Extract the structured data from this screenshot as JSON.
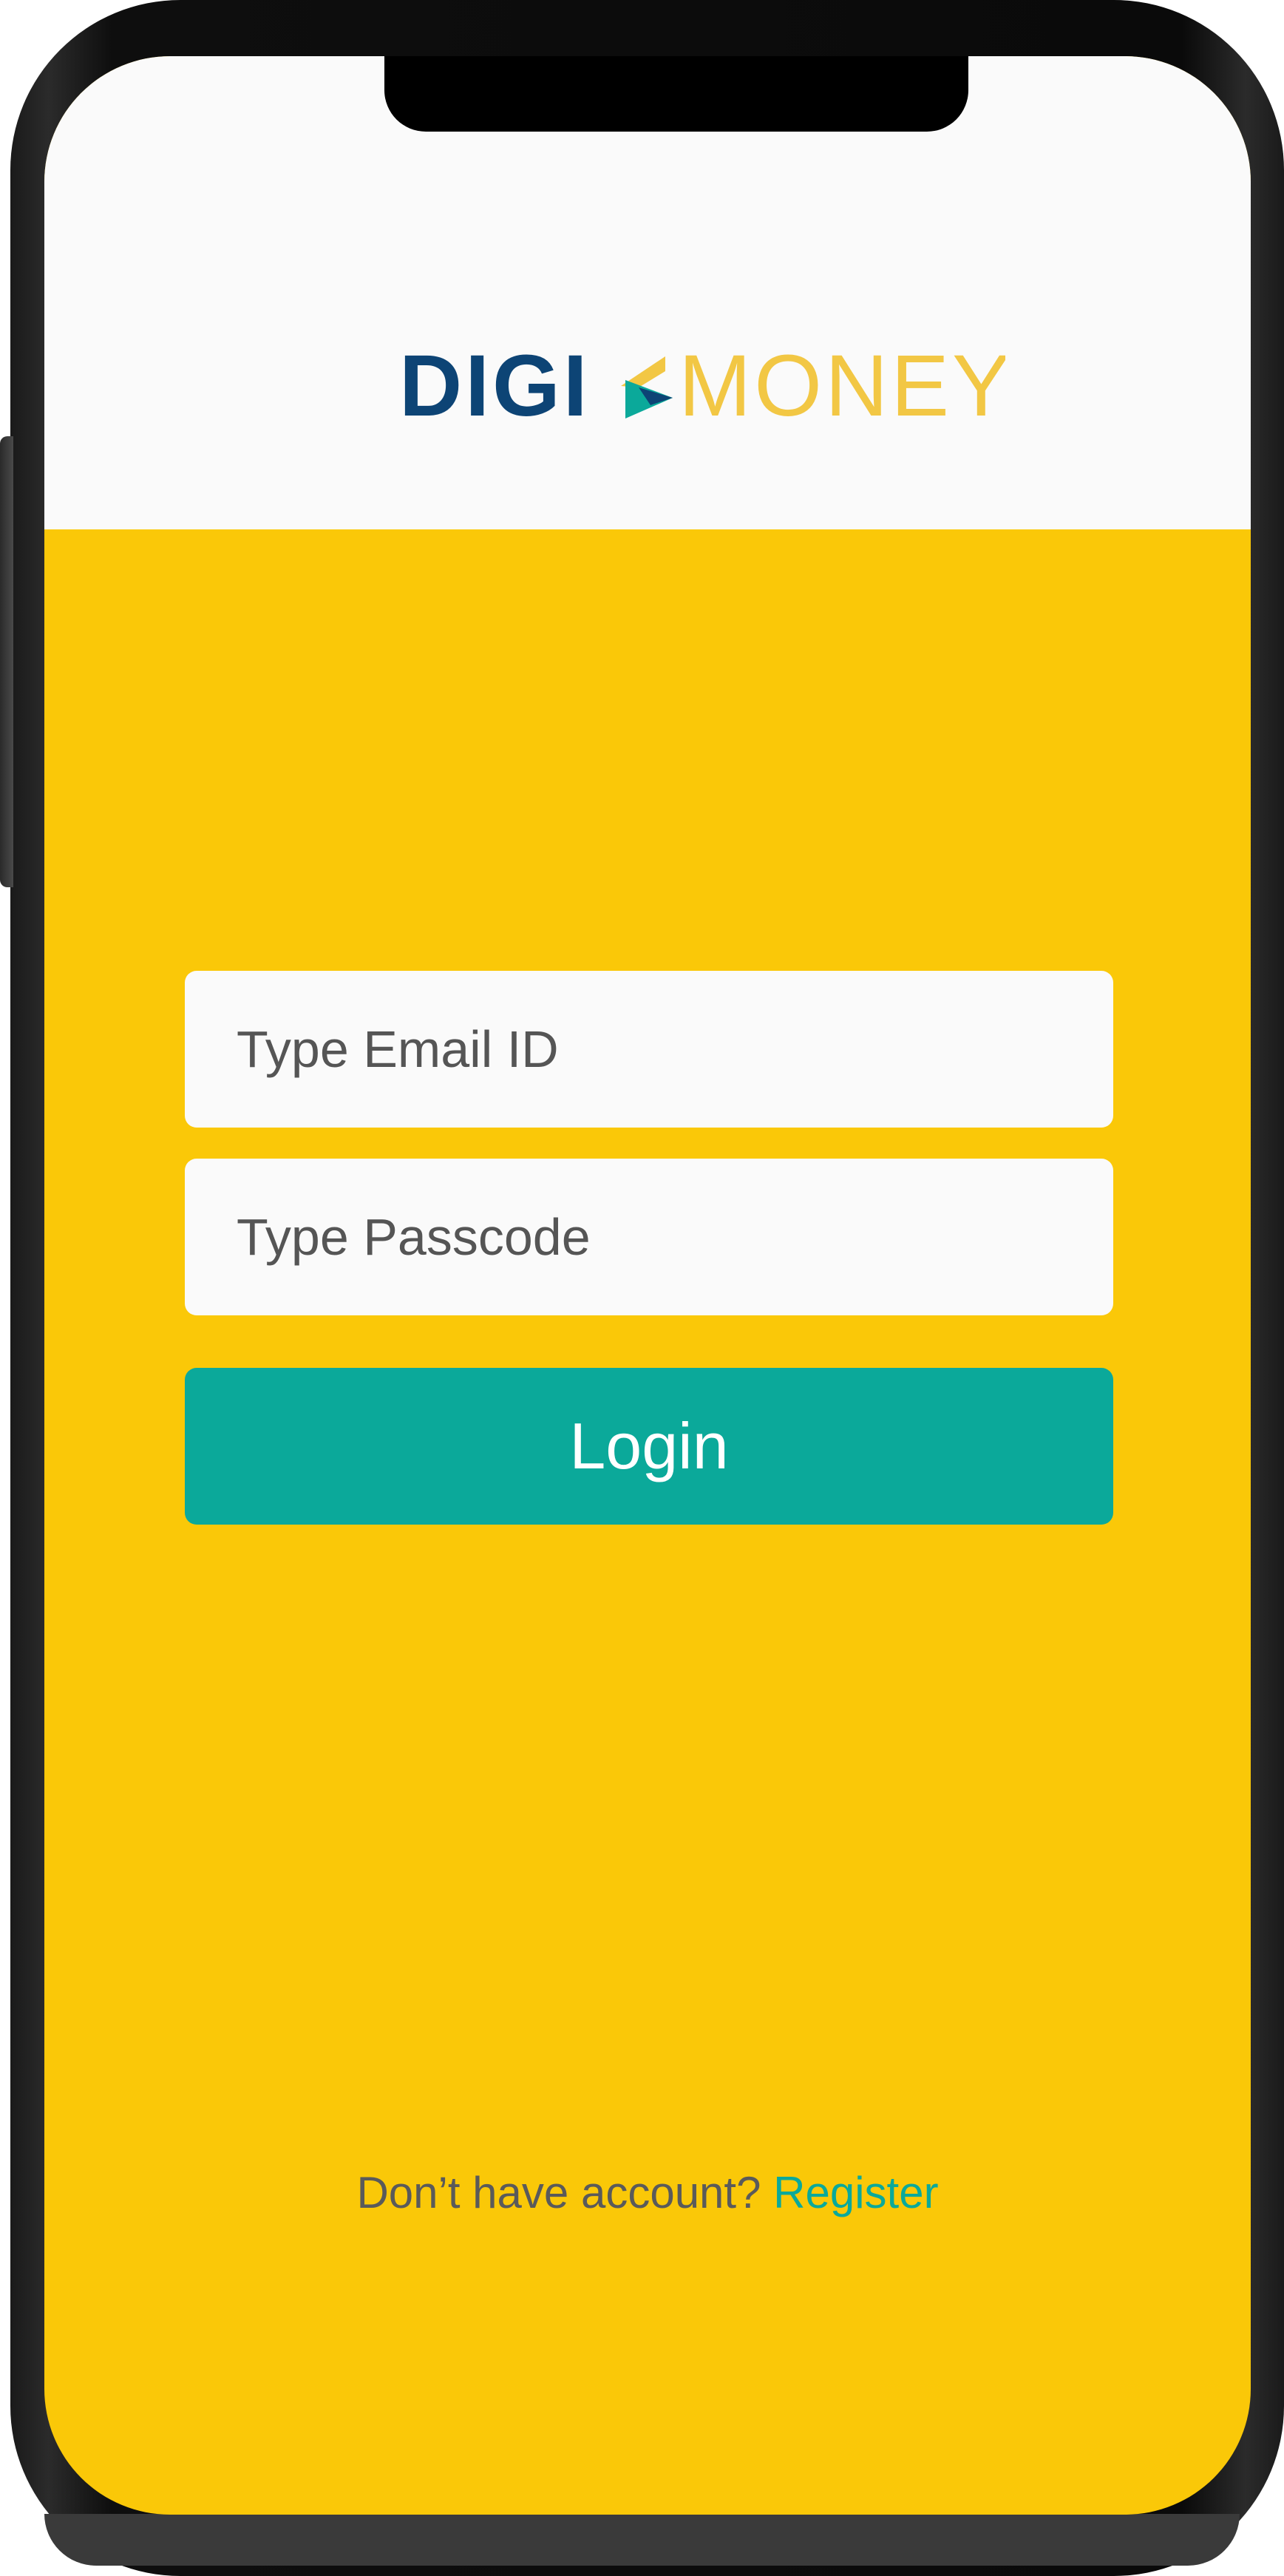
{
  "app": {
    "logo": {
      "part1": "DIGI",
      "part2": "MONEY",
      "colors": {
        "dark": "#0d4475",
        "accent": "#f2c744",
        "teal": "#0ba99a"
      }
    }
  },
  "form": {
    "email_placeholder": "Type Email ID",
    "passcode_placeholder": "Type Passcode",
    "login_label": "Login"
  },
  "footer": {
    "prompt": "Don’t have account? ",
    "register_label": "Register"
  },
  "colors": {
    "background": "#fac808",
    "header": "#fafafa",
    "button": "#0ba99a"
  }
}
